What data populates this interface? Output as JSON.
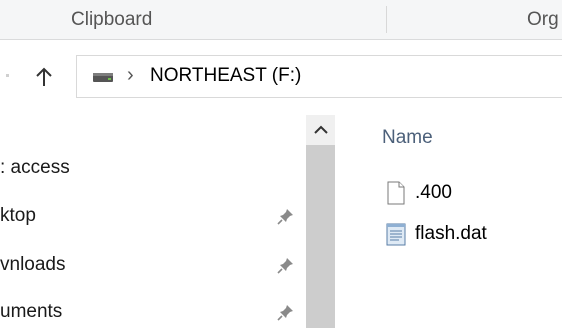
{
  "ribbon": {
    "groups": [
      "Clipboard",
      "Org"
    ]
  },
  "toolbar": {
    "up_icon": "arrow-up-icon"
  },
  "address": {
    "drive_icon": "drive-icon",
    "separator": "›",
    "current": "NORTHEAST (F:)"
  },
  "nav": {
    "items": [
      {
        "label": ": access",
        "pinned": false
      },
      {
        "label": "ktop",
        "pinned": true
      },
      {
        "label": "vnloads",
        "pinned": true
      },
      {
        "label": "uments",
        "pinned": true
      }
    ],
    "pin_icon": "pin-icon"
  },
  "file_list": {
    "column_header": "Name",
    "files": [
      {
        "name": ".400",
        "icon": "blank-file-icon"
      },
      {
        "name": "flash.dat",
        "icon": "text-document-icon"
      }
    ]
  },
  "colors": {
    "ribbon_bg": "#f5f6f7",
    "header_text": "#4c607a",
    "scrollbar_track": "#f0f0f0",
    "scrollbar_thumb": "#cdcdcd"
  }
}
